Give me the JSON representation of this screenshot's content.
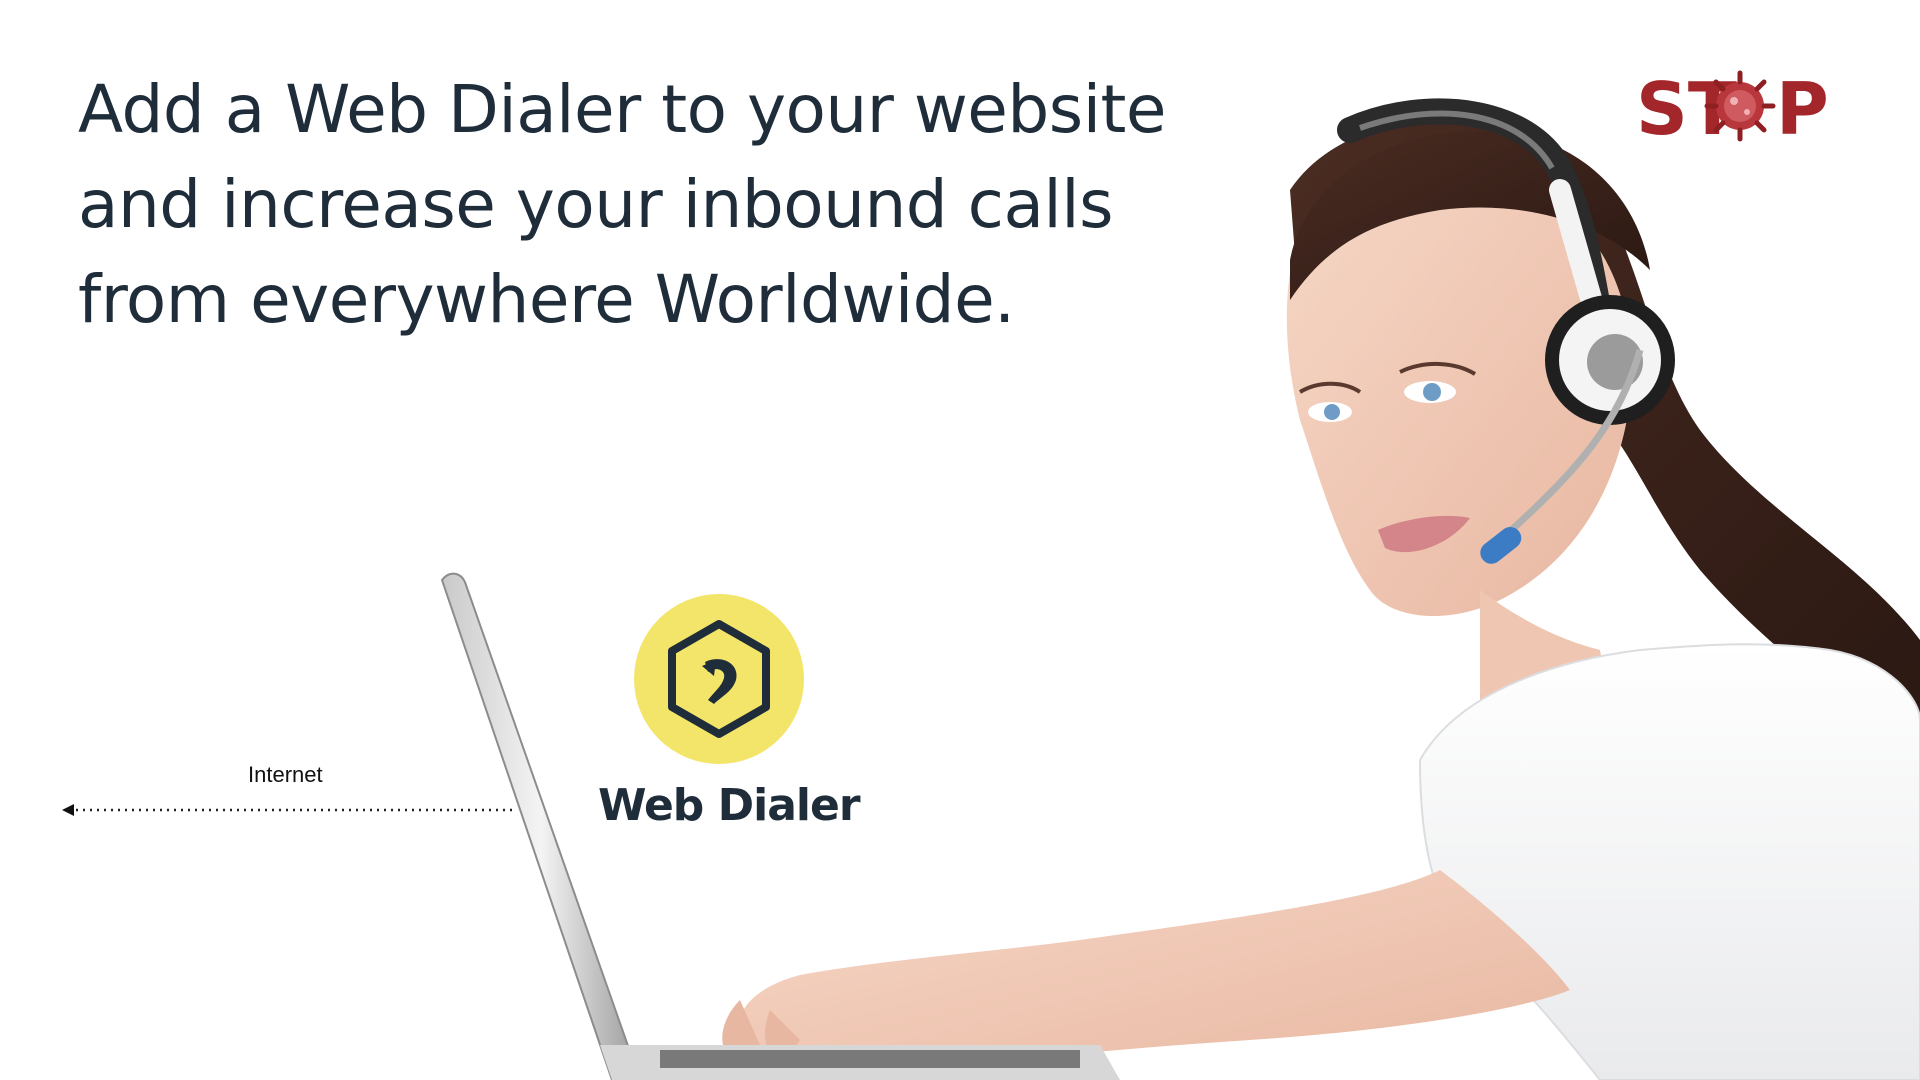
{
  "headline": {
    "line1": "Add a Web Dialer to your website",
    "line2": "and increase your inbound calls",
    "line3": "from everywhere Worldwide."
  },
  "stop_logo": {
    "text_left": "ST",
    "text_right": "P",
    "icon": "virus-icon",
    "color": "#a3262a"
  },
  "diagram": {
    "internet_label": "Internet",
    "arrow_icon": "arrow-left-icon"
  },
  "web_dialer": {
    "name": "Web Dialer",
    "badge_color": "#f3e56a",
    "icon": "hexagon-phone-icon"
  },
  "photo": {
    "subject": "person-with-headset-at-laptop"
  }
}
